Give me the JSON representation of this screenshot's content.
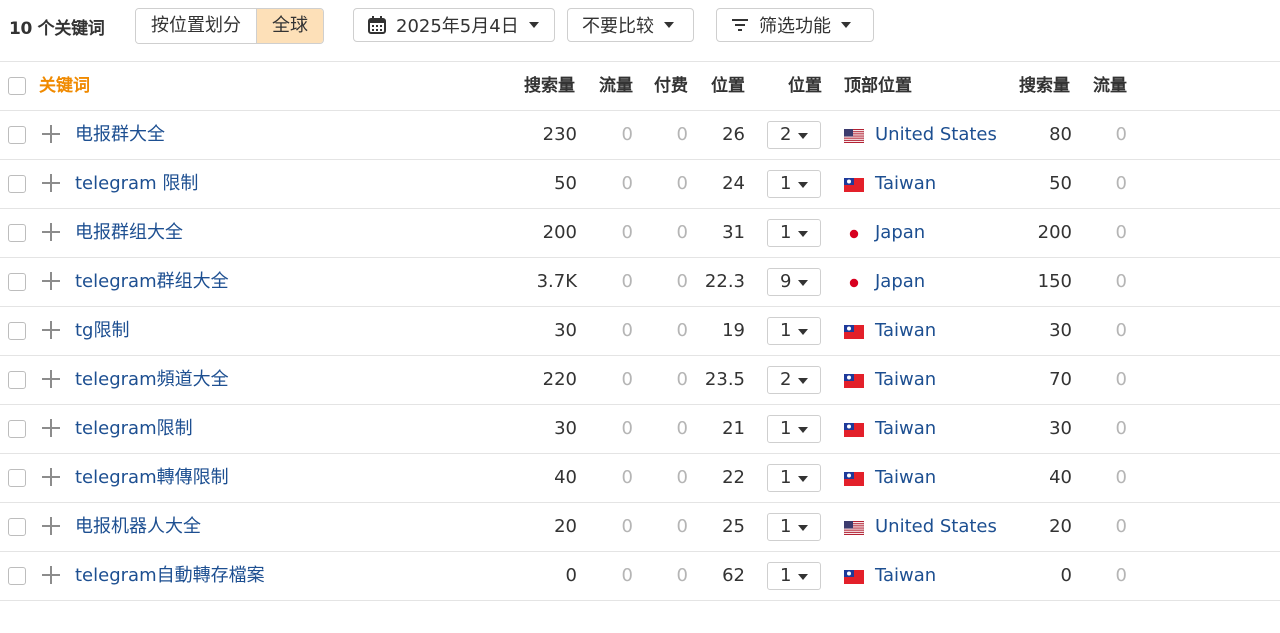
{
  "toolbar": {
    "count_label": "10 个关键词",
    "seg_by_location": "按位置划分",
    "seg_global": "全球",
    "date_label": "2025年5月4日",
    "compare_label": "不要比较",
    "filter_label": "筛选功能"
  },
  "header": {
    "keyword": "关键词",
    "volume": "搜索量",
    "traffic": "流量",
    "paid": "付费",
    "position": "位置",
    "position2": "位置",
    "top_location": "顶部位置",
    "volume2": "搜索量",
    "traffic2": "流量"
  },
  "rows": [
    {
      "keyword": "电报群大全",
      "volume": "230",
      "traffic": "0",
      "paid": "0",
      "position": "26",
      "select": "2",
      "flag": "us",
      "country": "United States",
      "vol2": "80",
      "traffic2": "0"
    },
    {
      "keyword": "telegram 限制",
      "volume": "50",
      "traffic": "0",
      "paid": "0",
      "position": "24",
      "select": "1",
      "flag": "tw",
      "country": "Taiwan",
      "vol2": "50",
      "traffic2": "0"
    },
    {
      "keyword": "电报群组大全",
      "volume": "200",
      "traffic": "0",
      "paid": "0",
      "position": "31",
      "select": "1",
      "flag": "jp",
      "country": "Japan",
      "vol2": "200",
      "traffic2": "0"
    },
    {
      "keyword": "telegram群组大全",
      "volume": "3.7K",
      "traffic": "0",
      "paid": "0",
      "position": "22.3",
      "select": "9",
      "flag": "jp",
      "country": "Japan",
      "vol2": "150",
      "traffic2": "0"
    },
    {
      "keyword": "tg限制",
      "volume": "30",
      "traffic": "0",
      "paid": "0",
      "position": "19",
      "select": "1",
      "flag": "tw",
      "country": "Taiwan",
      "vol2": "30",
      "traffic2": "0"
    },
    {
      "keyword": "telegram頻道大全",
      "volume": "220",
      "traffic": "0",
      "paid": "0",
      "position": "23.5",
      "select": "2",
      "flag": "tw",
      "country": "Taiwan",
      "vol2": "70",
      "traffic2": "0"
    },
    {
      "keyword": "telegram限制",
      "volume": "30",
      "traffic": "0",
      "paid": "0",
      "position": "21",
      "select": "1",
      "flag": "tw",
      "country": "Taiwan",
      "vol2": "30",
      "traffic2": "0"
    },
    {
      "keyword": "telegram轉傳限制",
      "volume": "40",
      "traffic": "0",
      "paid": "0",
      "position": "22",
      "select": "1",
      "flag": "tw",
      "country": "Taiwan",
      "vol2": "40",
      "traffic2": "0"
    },
    {
      "keyword": "电报机器人大全",
      "volume": "20",
      "traffic": "0",
      "paid": "0",
      "position": "25",
      "select": "1",
      "flag": "us",
      "country": "United States",
      "vol2": "20",
      "traffic2": "0"
    },
    {
      "keyword": "telegram自動轉存檔案",
      "volume": "0",
      "traffic": "0",
      "paid": "0",
      "position": "62",
      "select": "1",
      "flag": "tw",
      "country": "Taiwan",
      "vol2": "0",
      "traffic2": "0"
    }
  ],
  "colors": {
    "accent": "#f08a00",
    "link": "#1d4f91",
    "active_segment": "#fde0b8",
    "muted": "#b5b5b5"
  }
}
